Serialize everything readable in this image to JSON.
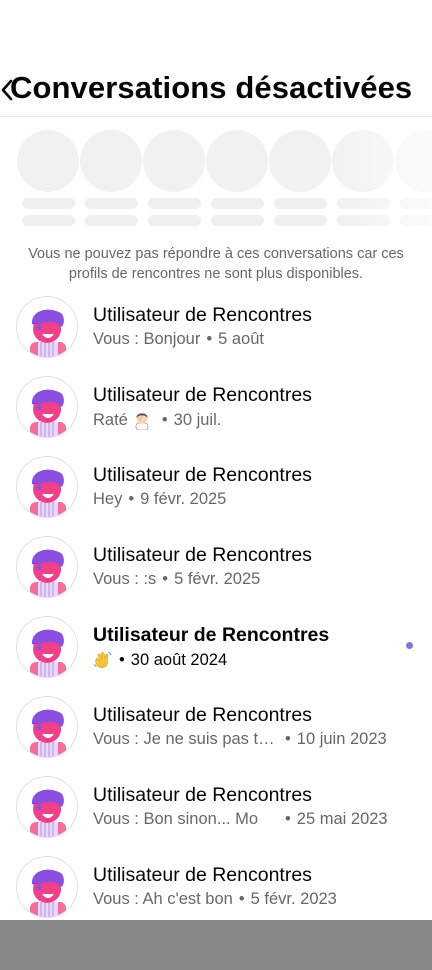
{
  "header": {
    "back_icon": "chevron-left-icon",
    "title": "Conversations désactivées"
  },
  "notice": "Vous ne pouvez pas répondre à ces conversations car ces profils de rencontres ne sont plus disponibles.",
  "colors": {
    "primary_text": "#050505",
    "secondary_text": "#65676b",
    "unread_dot": "#7f77d8",
    "avatar_hair": "#8a4fe0",
    "avatar_face": "#f0408a",
    "placeholder": "#f0f1f3",
    "bottom_bar": "#878787"
  },
  "conversations": [
    {
      "name": "Utilisateur de Rencontres",
      "snippet": "Vous : Bonjour",
      "date": "5 août"
    },
    {
      "name": "Utilisateur de Rencontres",
      "snippet": "Raté",
      "emoji": "woman-facepalming-icon",
      "date": "30 juil."
    },
    {
      "name": "Utilisateur de Rencontres",
      "snippet": "Hey",
      "date": "9 févr. 2025"
    },
    {
      "name": "Utilisateur de Rencontres",
      "snippet": "Vous : :s",
      "date": "5 févr. 2025"
    },
    {
      "name": "Utilisateur de Rencontres",
      "snippet": "",
      "emoji": "waving-hand-icon",
      "date": "30 août 2024",
      "unread": true
    },
    {
      "name": "Utilisateur de Rencontres",
      "snippet": "Vous : Je ne suis pas trop",
      "date": "10 juin 2023"
    },
    {
      "name": "Utilisateur de Rencontres",
      "snippet": "Vous : Bon sinon... Mo",
      "date": "25 mai 2023"
    },
    {
      "name": "Utilisateur de Rencontres",
      "snippet": "Vous : Ah c'est bon",
      "date": "5 févr. 2023"
    }
  ]
}
